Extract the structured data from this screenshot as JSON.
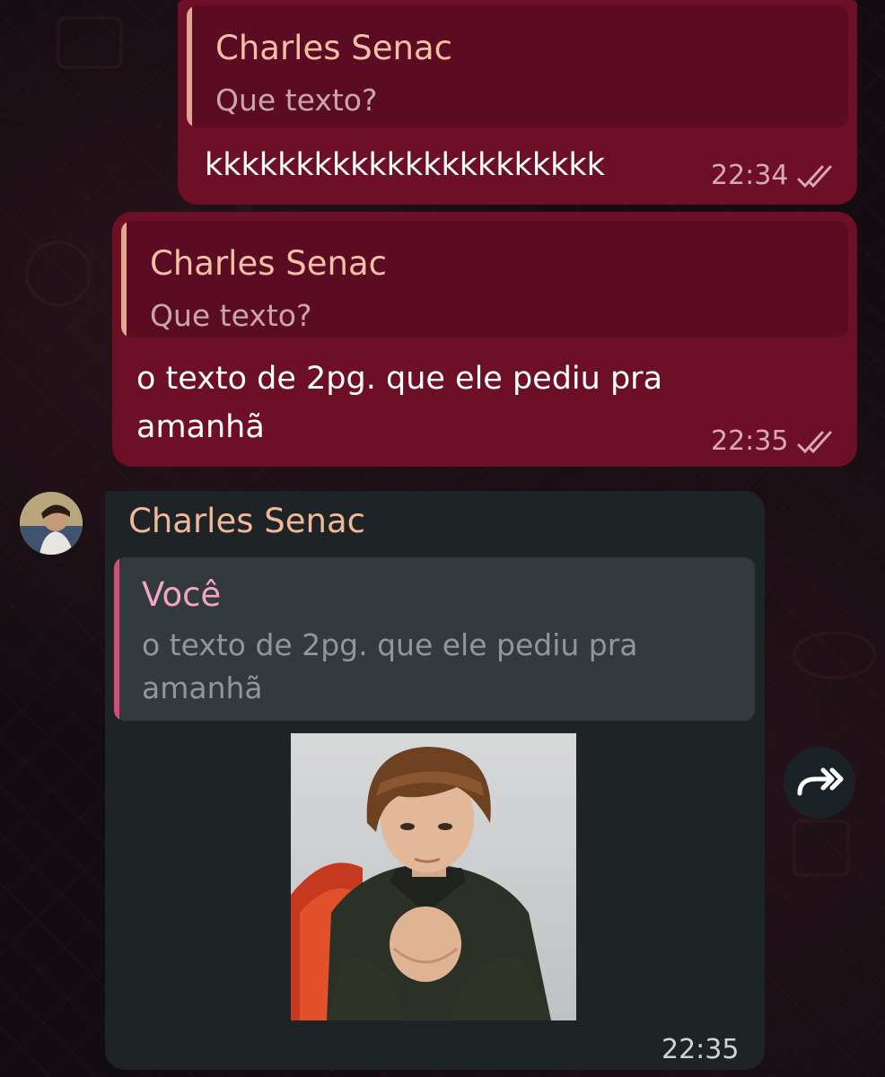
{
  "colors": {
    "outgoing_bubble": "#6c0f27",
    "incoming_bubble": "#1e2326",
    "quote_bar_outgoing": "#e6a58e",
    "quote_bar_incoming": "#d64f72",
    "sender_name": "#f0b89a"
  },
  "messages": [
    {
      "quote_author": "Charles Senac",
      "quote_text": "Que texto?",
      "text": "kkkkkkkkkkkkkkkkkkkkkk",
      "time": "22:34",
      "status": "double-check-icon"
    },
    {
      "quote_author": "Charles Senac",
      "quote_text": "Que texto?",
      "text_line1": "o texto de 2pg. que ele pediu pra",
      "text_line2": "amanhã",
      "time": "22:35",
      "status": "double-check-icon"
    },
    {
      "sender": "Charles Senac",
      "quote_author": "Você",
      "quote_line1": "o texto de 2pg. que ele pediu pra",
      "quote_line2": "amanhã",
      "image": "photo-of-boy-in-dark-hoodie",
      "time": "22:35"
    }
  ],
  "actions": {
    "forward_icon": "forward-icon"
  }
}
